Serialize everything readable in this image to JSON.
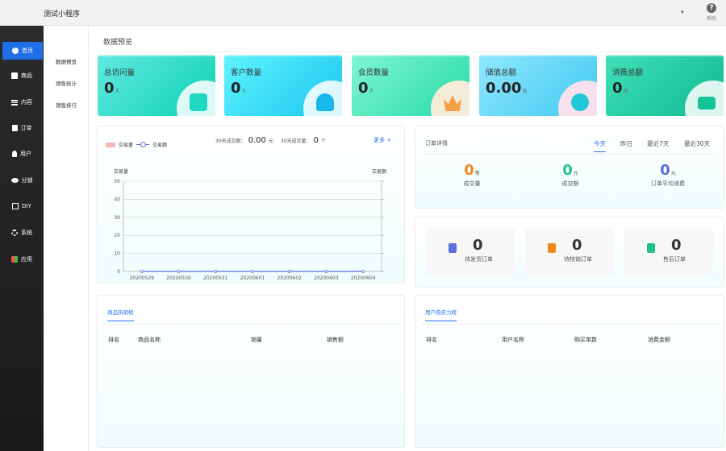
{
  "app": {
    "title": "测试小程序",
    "help_label": "帮助",
    "dropdown": "▾"
  },
  "sidebar": [
    {
      "label": "首页",
      "icon": "pie-icon",
      "active": true
    },
    {
      "label": "商品",
      "icon": "product-icon"
    },
    {
      "label": "内容",
      "icon": "list-icon"
    },
    {
      "label": "订单",
      "icon": "order-icon"
    },
    {
      "label": "用户",
      "icon": "user-icon"
    },
    {
      "label": "分销",
      "icon": "users-icon"
    },
    {
      "label": "DIY",
      "icon": "diy-icon"
    },
    {
      "label": "系统",
      "icon": "gear-icon"
    },
    {
      "label": "应用",
      "icon": "apps-icon"
    }
  ],
  "subnav": [
    "数据预览",
    "销售统计",
    "销售排行"
  ],
  "page": {
    "title": "数据预览"
  },
  "stats": [
    {
      "label": "总访问量",
      "value": "0",
      "unit": "人",
      "color": "#19d6c7"
    },
    {
      "label": "客户数量",
      "value": "0",
      "unit": "人",
      "color": "#1fd0f0"
    },
    {
      "label": "会员数量",
      "value": "0",
      "unit": "人",
      "color": "#36e3b8"
    },
    {
      "label": "储值总额",
      "value": "0.00",
      "unit": "元",
      "color": "#4fd3f5"
    },
    {
      "label": "消费总额",
      "value": "0",
      "unit": "元",
      "color": "#19c7a0"
    }
  ],
  "trade": {
    "legend_bar": "交易量",
    "legend_line": "交易额",
    "summary_amount_label": "30天成交额：",
    "summary_amount": "0.00",
    "summary_amount_unit": "元",
    "summary_count_label": "30天成交量：",
    "summary_count": "0",
    "summary_count_unit": "个",
    "more": "更多 +"
  },
  "chart_data": {
    "type": "bar",
    "categories": [
      "20200529",
      "20200530",
      "20200531",
      "20200601",
      "20200602",
      "20200603",
      "20200604"
    ],
    "series": [
      {
        "name": "交易量",
        "values": [
          0,
          0,
          0,
          0,
          0,
          0,
          0
        ]
      },
      {
        "name": "交易额",
        "values": [
          0,
          0,
          0,
          0,
          0,
          0,
          0
        ]
      }
    ],
    "y_left_label": "交易量",
    "y_right_label": "交易额",
    "y_ticks": [
      0,
      10,
      20,
      30,
      40,
      50
    ],
    "ylim": [
      0,
      50
    ],
    "grid": true,
    "legend": "top-left"
  },
  "order_detail": {
    "title": "订单详情",
    "ranges": [
      "今天",
      "昨日",
      "最近7天",
      "最近30天"
    ],
    "active_range": "今天",
    "stats": [
      {
        "value": "0",
        "unit": "笔",
        "label": "成交量",
        "color": "#f08a1c"
      },
      {
        "value": "0",
        "unit": "元",
        "label": "成交额",
        "color": "#1fc28b"
      },
      {
        "value": "0",
        "unit": "元",
        "label": "订单平均消费",
        "color": "#5b6fe0"
      }
    ]
  },
  "orders": [
    {
      "value": "0",
      "label": "待发货订单",
      "color": "#5b6fe0"
    },
    {
      "value": "0",
      "label": "待核销订单",
      "color": "#f08a1c"
    },
    {
      "value": "0",
      "label": "售后订单",
      "color": "#1fc28b"
    }
  ],
  "hot_goods": {
    "tab": "商品热销榜",
    "columns": [
      "排名",
      "商品名称",
      "销量",
      "销售额"
    ]
  },
  "buyers": {
    "tab": "用户购买力榜",
    "columns": [
      "排名",
      "用户名称",
      "购买单数",
      "消费金额"
    ]
  }
}
